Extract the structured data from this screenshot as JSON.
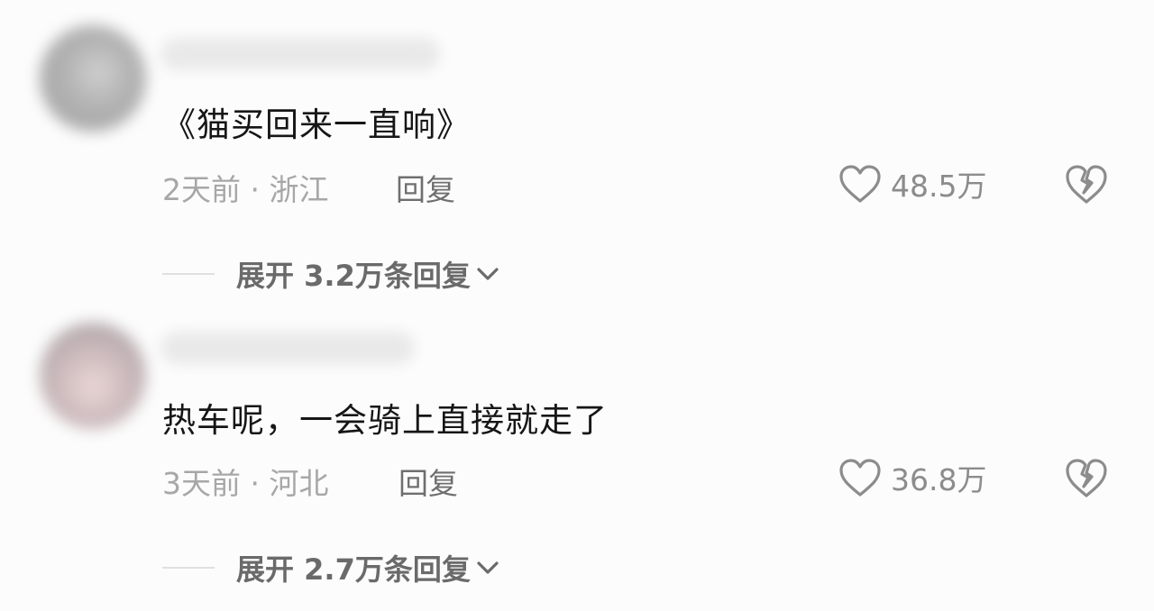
{
  "comments": [
    {
      "text": "《猫买回来一直响》",
      "time_location": "2天前 · 浙江",
      "reply_label": "回复",
      "likes": "48.5万",
      "expand_label": "展开 3.2万条回复"
    },
    {
      "text": "热车呢，一会骑上直接就走了",
      "time_location": "3天前 · 河北",
      "reply_label": "回复",
      "likes": "36.8万",
      "expand_label": "展开 2.7万条回复"
    }
  ],
  "icons": {
    "like": "heart-outline-icon",
    "dislike": "broken-heart-icon",
    "expand": "chevron-down-icon"
  },
  "colors": {
    "text_primary": "#161616",
    "text_meta": "#a7a7a7",
    "text_reply": "#6f6f6f",
    "icon_stroke": "#8c8c8c"
  }
}
